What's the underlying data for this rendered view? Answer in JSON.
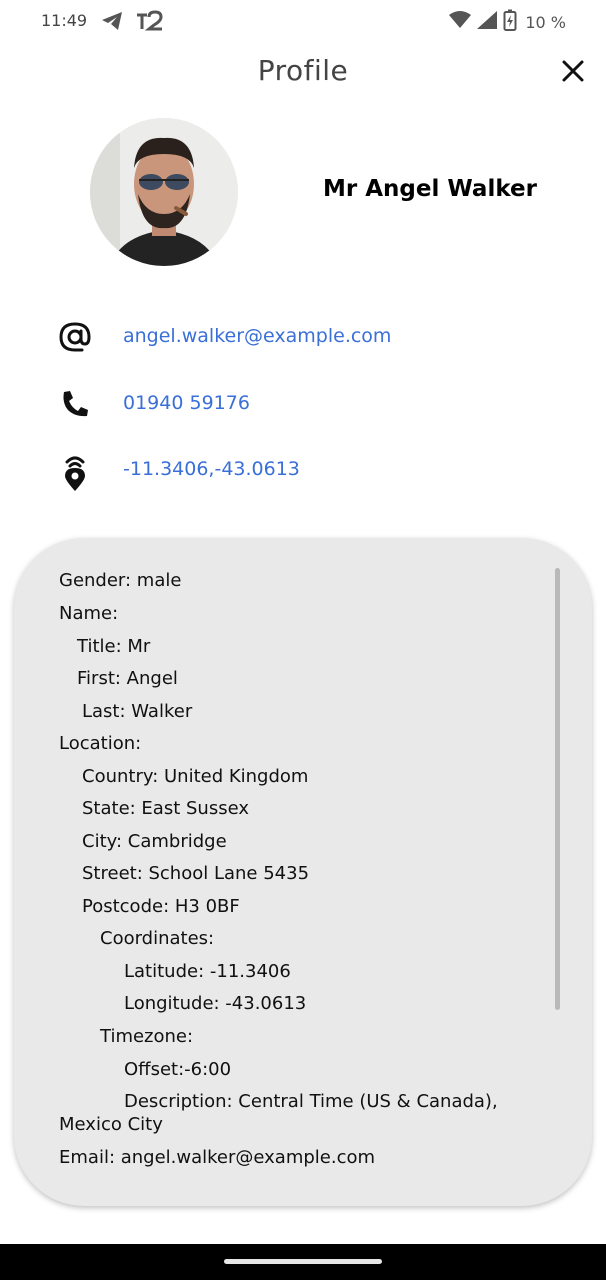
{
  "status_bar": {
    "time": "11:49",
    "left_icons": [
      "telegram-icon",
      "t2-icon"
    ],
    "right_icons": [
      "wifi-icon",
      "signal-icon",
      "battery-charging-icon"
    ],
    "battery_text": "10 %"
  },
  "app_bar": {
    "title": "Profile",
    "close_icon": "close-icon"
  },
  "profile": {
    "name": "Mr Angel Walker",
    "avatar_icon": "avatar-photo"
  },
  "contacts": {
    "email": {
      "icon": "at-sign-icon",
      "value": "angel.walker@example.com"
    },
    "phone": {
      "icon": "phone-icon",
      "value": "01940 59176"
    },
    "location": {
      "icon": "location-signal-icon",
      "value": "-11.3406,-43.0613"
    }
  },
  "details": {
    "gender": "Gender: male",
    "name_header": "Name:",
    "title": "Title: Mr",
    "first": "First: Angel",
    "last": "Last: Walker",
    "location_header": "Location:",
    "country": "Country: United Kingdom",
    "state": "State: East Sussex",
    "city": "City: Cambridge",
    "street": "Street: School Lane 5435",
    "postcode": "Postcode: H3 0BF",
    "coordinates_header": "Coordinates:",
    "latitude": "Latitude: -11.3406",
    "longitude": "Longitude: -43.0613",
    "timezone_header": "Timezone:",
    "offset": "Offset:-6:00",
    "description_line1": "Description: Central Time (US & Canada),",
    "description_line2": "Mexico City",
    "email": "Email: angel.walker@example.com"
  },
  "colors": {
    "link": "#3a6fd8",
    "card_background": "#e9e9e9",
    "title_text": "#444444"
  }
}
